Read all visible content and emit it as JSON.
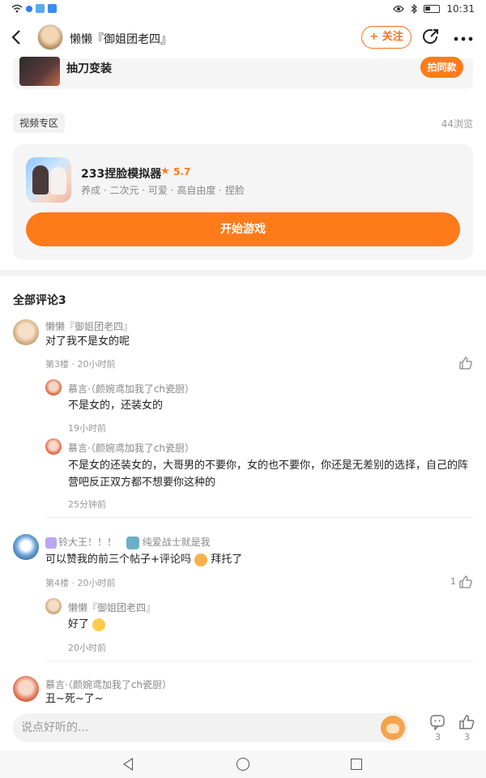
{
  "status_bar": {
    "time": "10:31",
    "app_badge_1": "",
    "app_badge_2": ""
  },
  "header": {
    "title": "懒懒『御姐团老四』",
    "follow_label": "+ 关注"
  },
  "top_card": {
    "title": "抽刀变装",
    "shoot_button": "拍同款"
  },
  "video_zone": {
    "tag": "视频专区",
    "views": "44浏览"
  },
  "game": {
    "name": "233捏脸模拟器",
    "rating": "5.7",
    "tags": "养成 · 二次元 · 可爱 · 高自由度 · 捏脸",
    "play_button": "开始游戏"
  },
  "comments_header": "全部评论3",
  "comments": [
    {
      "user": "懒懒『御姐团老四』",
      "text": "对了我不是女的呢",
      "meta": "第3楼 · 20小时前",
      "likes": "",
      "replies": [
        {
          "user": "慕言·（颜婉鸢加我了ch瓷厨）",
          "text": "不是女的，还装女的",
          "meta": "19小时前"
        },
        {
          "user": "慕言·（颜婉鸢加我了ch瓷厨）",
          "text": "不是女的还装女的，大哥男的不要你，女的也不要你，你还是无差别的选择，自己的阵营吧反正双方都不想要你这种的",
          "meta": "25分钟前"
        }
      ]
    },
    {
      "user": "铃大王！！！",
      "badge_text": "纯爱战士就是我",
      "text": "可以赞我的前三个帖子+评论吗",
      "text_suffix": "拜托了",
      "meta": "第4楼 · 20小时前",
      "likes": "1",
      "replies": [
        {
          "user": "懒懒『御姐团老四』",
          "text": "好了",
          "meta": "20小时前"
        }
      ]
    },
    {
      "user": "慕言·（颜婉鸢加我了ch瓷厨）",
      "text": "丑~死~了~"
    }
  ],
  "input_bar": {
    "placeholder": "说点好听的...",
    "comment_count": "3",
    "like_count": "3"
  }
}
